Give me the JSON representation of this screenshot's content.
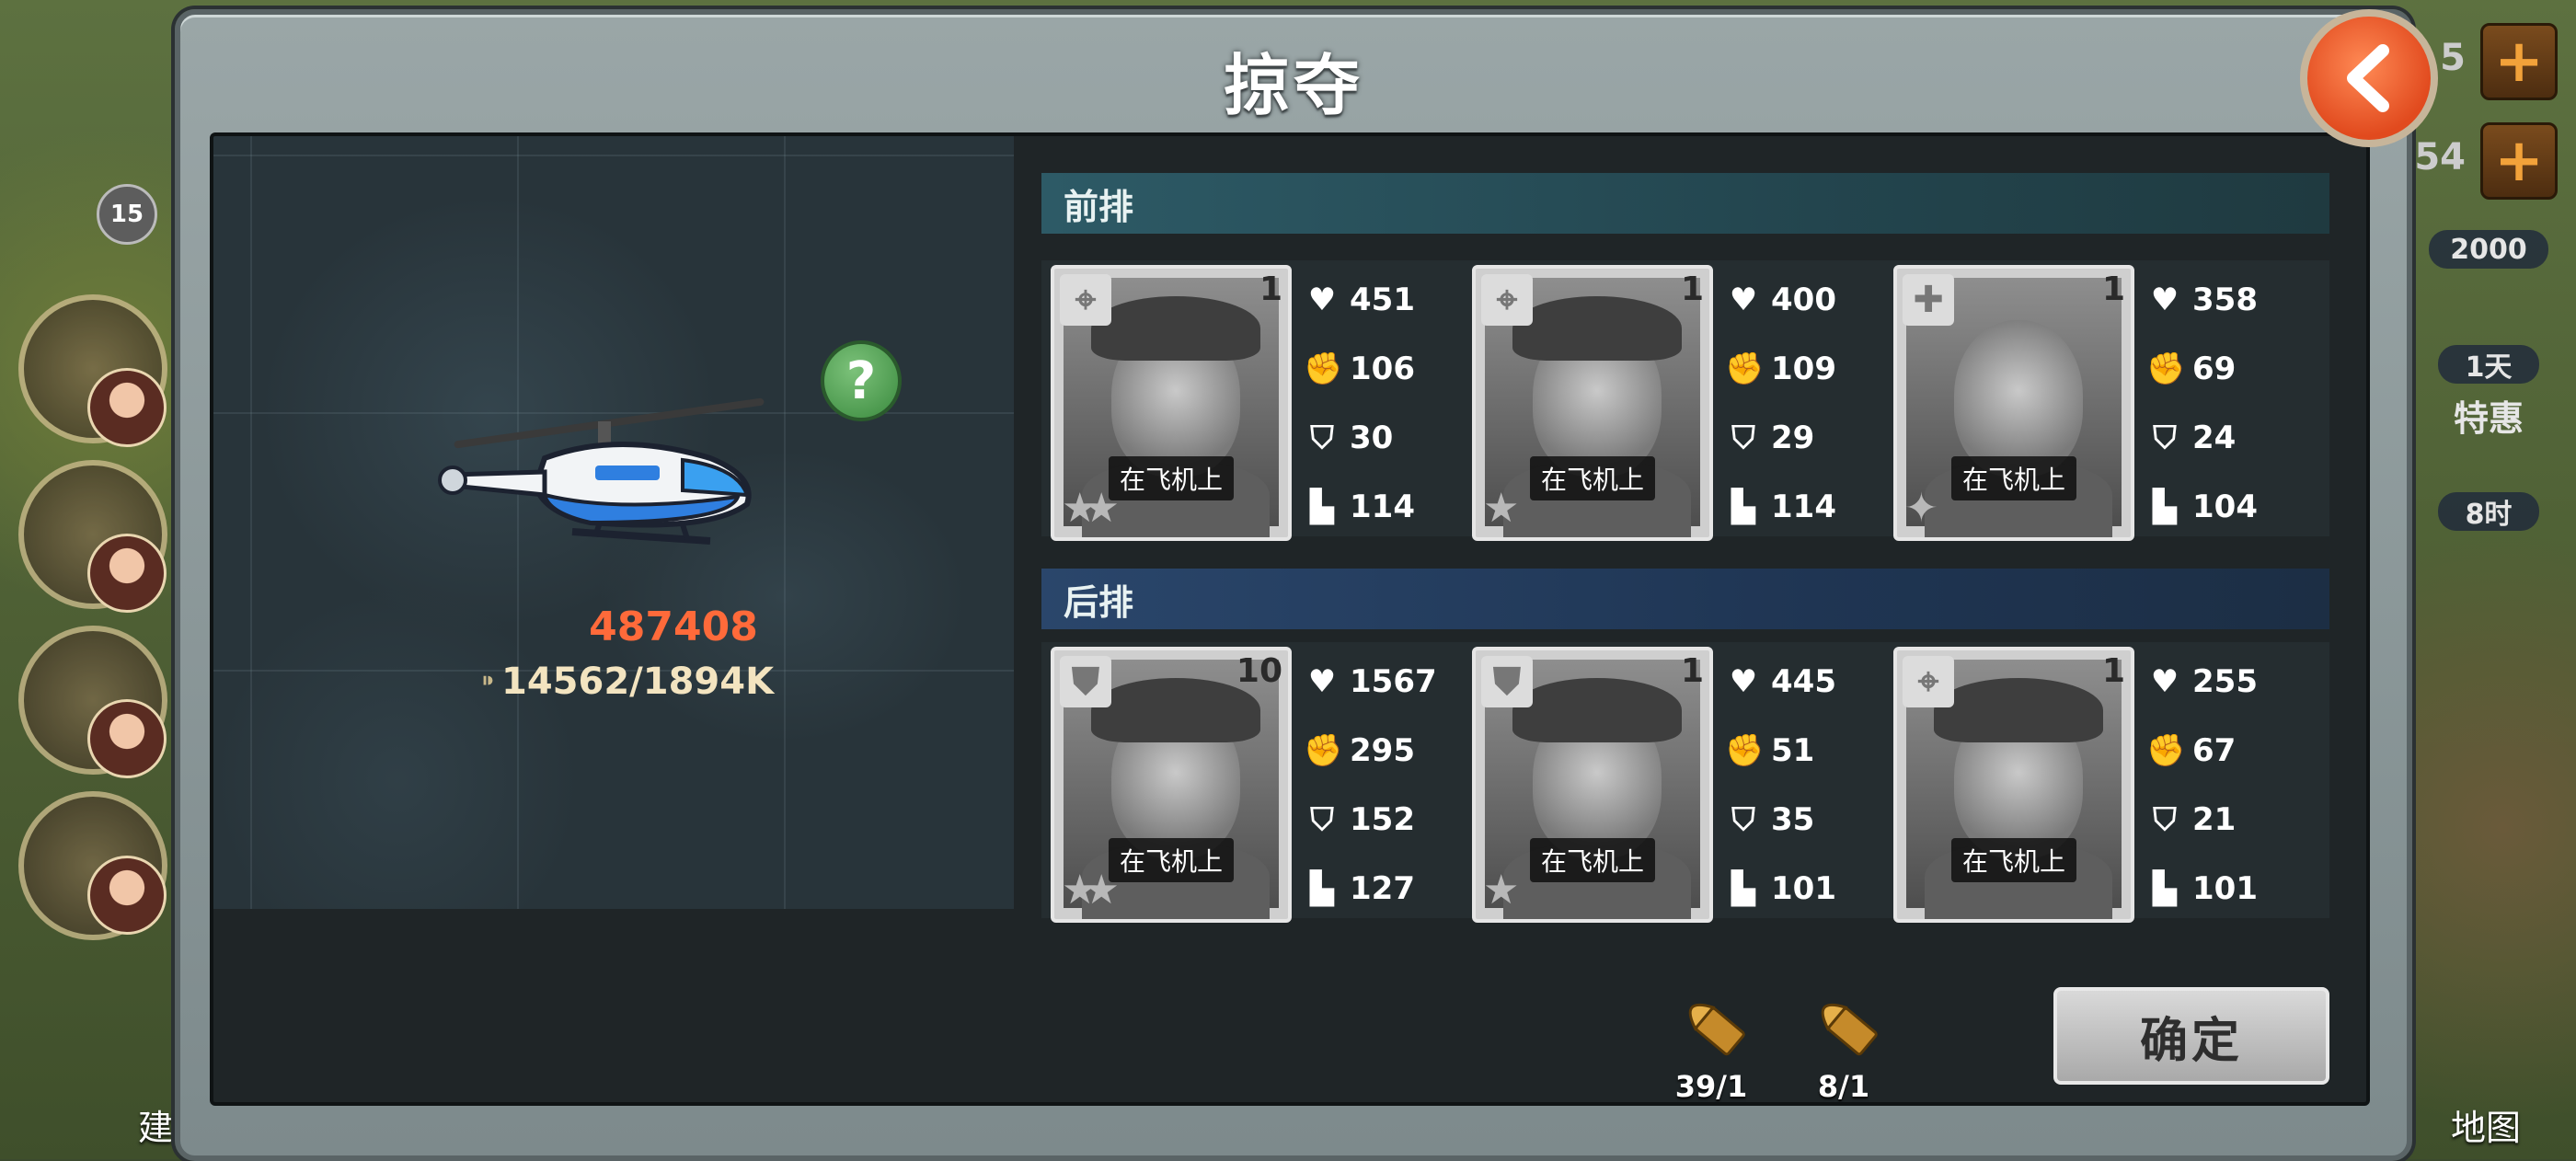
{
  "title": "掠夺",
  "background": {
    "left_badge": "15",
    "build_label": "建",
    "map_label": "地图",
    "res_top": "5",
    "res_second": "54",
    "gems": "2000",
    "timer_1": "1天",
    "offer_label": "特惠",
    "timer_2": "8时"
  },
  "vehicle": {
    "power": "487408",
    "capacity": "14562/1894K"
  },
  "front_row": {
    "label": "前排",
    "slot_number": "1"
  },
  "back_row": {
    "label": "后排"
  },
  "heroes": [
    {
      "level": "1",
      "status": "在飞机上",
      "hp": "451",
      "atk": "106",
      "def": "30",
      "spd": "114"
    },
    {
      "level": "1",
      "status": "在飞机上",
      "hp": "400",
      "atk": "109",
      "def": "29",
      "spd": "114"
    },
    {
      "level": "1",
      "status": "在飞机上",
      "hp": "358",
      "atk": "69",
      "def": "24",
      "spd": "104"
    },
    {
      "level": "10",
      "status": "在飞机上",
      "hp": "1567",
      "atk": "295",
      "def": "152",
      "spd": "127"
    },
    {
      "level": "1",
      "status": "在飞机上",
      "hp": "445",
      "atk": "51",
      "def": "35",
      "spd": "101"
    },
    {
      "level": "1",
      "status": "在飞机上",
      "hp": "255",
      "atk": "67",
      "def": "21",
      "spd": "101"
    }
  ],
  "ammo": [
    {
      "count": "39/1"
    },
    {
      "count": "8/1"
    }
  ],
  "confirm_label": "确定",
  "colors": {
    "power": "#ff6a3a",
    "slot_active": "#f0b21a",
    "back_button": "#e14a1e"
  }
}
